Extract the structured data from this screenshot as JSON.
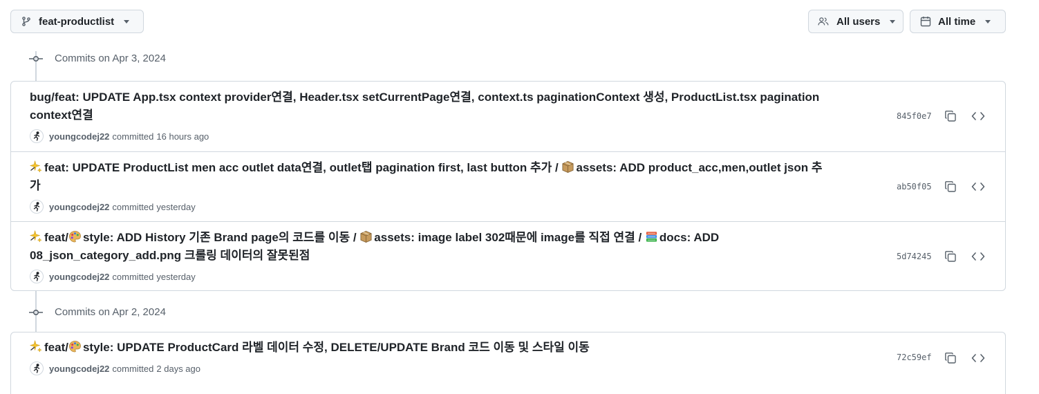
{
  "filters": {
    "branch": "feat-productlist",
    "users": "All users",
    "time": "All time"
  },
  "groups": [
    {
      "date": "Commits on Apr 3, 2024",
      "commits": [
        {
          "message": "bug/feat: UPDATE App.tsx context provider연결, Header.tsx setCurrentPage연결, context.ts paginationContext 생성, ProductList.tsx pagination context연결",
          "author": "youngcodej22",
          "committed": "committed",
          "time": "16 hours ago",
          "sha": "845f0e7"
        },
        {
          "segments": [
            {
              "emoji": "sparkles-emoji"
            },
            {
              "text": "feat: UPDATE ProductList men acc outlet data연결, outlet탭 pagination first, last button 추가 / "
            },
            {
              "emoji": "package-emoji"
            },
            {
              "text": "assets: ADD product_acc,men,outlet json 추가"
            }
          ],
          "author": "youngcodej22",
          "committed": "committed",
          "time": "yesterday",
          "sha": "ab50f05"
        },
        {
          "segments": [
            {
              "emoji": "sparkles-emoji"
            },
            {
              "text": "feat/"
            },
            {
              "emoji": "palette-emoji"
            },
            {
              "text": "style: ADD History 기존 Brand page의 코드를 이동 / "
            },
            {
              "emoji": "package-emoji"
            },
            {
              "text": "assets: image label 302때문에 image를 직접 연결 / "
            },
            {
              "emoji": "books-emoji"
            },
            {
              "text": "docs: ADD 08_json_category_add.png 크롤링 데이터의 잘못된점"
            }
          ],
          "author": "youngcodej22",
          "committed": "committed",
          "time": "yesterday",
          "sha": "5d74245"
        }
      ]
    },
    {
      "date": "Commits on Apr 2, 2024",
      "commits": [
        {
          "segments": [
            {
              "emoji": "sparkles-emoji"
            },
            {
              "text": "feat/"
            },
            {
              "emoji": "palette-emoji"
            },
            {
              "text": "style: UPDATE ProductCard 라벨 데이터 수정, DELETE/UPDATE Brand 코드 이동 및 스타일 이동"
            }
          ],
          "author": "youngcodej22",
          "committed": "committed",
          "time": "2 days ago",
          "sha": "72c59ef"
        }
      ]
    }
  ],
  "colors": {
    "border": "#d0d7de",
    "muted": "#57606a",
    "text": "#1f2328"
  }
}
